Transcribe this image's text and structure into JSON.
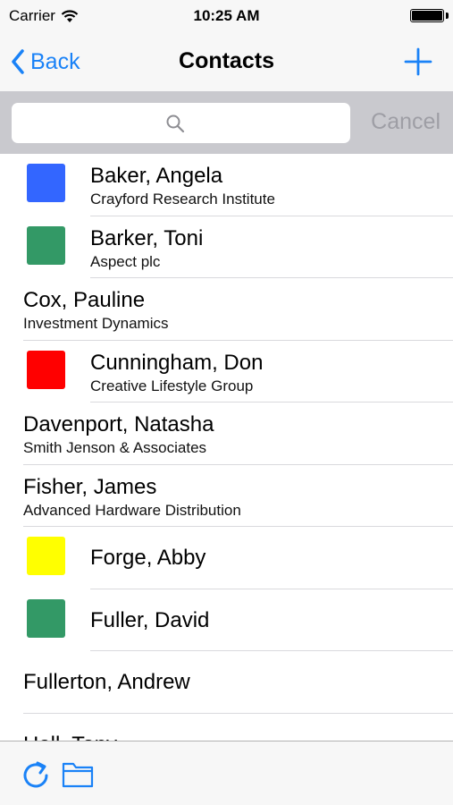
{
  "status_bar": {
    "carrier": "Carrier",
    "time": "10:25 AM",
    "battery_level": 1.0
  },
  "nav": {
    "back_label": "Back",
    "title": "Contacts",
    "add_icon": "plus-icon"
  },
  "search": {
    "placeholder": "",
    "value": "",
    "cancel_label": "Cancel"
  },
  "contacts": [
    {
      "name": "Baker, Angela",
      "company": "Crayford Research Institute",
      "color": "#3366ff"
    },
    {
      "name": "Barker, Toni",
      "company": "Aspect plc",
      "color": "#339966"
    },
    {
      "name": "Cox, Pauline",
      "company": "Investment Dynamics",
      "color": null
    },
    {
      "name": "Cunningham, Don",
      "company": "Creative Lifestyle Group",
      "color": "#ff0000"
    },
    {
      "name": "Davenport, Natasha",
      "company": "Smith Jenson & Associates",
      "color": null
    },
    {
      "name": "Fisher, James",
      "company": "Advanced Hardware Distribution",
      "color": null
    },
    {
      "name": "Forge, Abby",
      "company": "",
      "color": "#ffff00"
    },
    {
      "name": "Fuller, David",
      "company": "",
      "color": "#339966"
    },
    {
      "name": "Fullerton, Andrew",
      "company": "",
      "color": null
    },
    {
      "name": "Hall, Tony",
      "company": "",
      "color": null
    }
  ],
  "toolbar": {
    "refresh_icon": "refresh-icon",
    "folder_icon": "folder-icon"
  },
  "colors": {
    "accent": "#1a82f7",
    "bar_background": "#f7f7f7",
    "search_background": "#c9c9ce",
    "cancel_text": "#9e9ea5"
  }
}
